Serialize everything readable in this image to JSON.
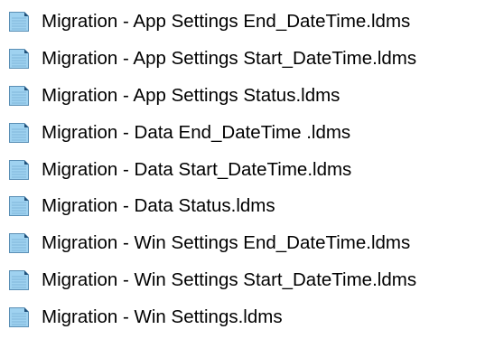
{
  "files": [
    {
      "name": "Migration - App Settings End_DateTime.ldms",
      "icon": "document-icon"
    },
    {
      "name": "Migration - App Settings Start_DateTime.ldms",
      "icon": "document-icon"
    },
    {
      "name": "Migration - App Settings Status.ldms",
      "icon": "document-icon"
    },
    {
      "name": "Migration - Data End_DateTime .ldms",
      "icon": "document-icon"
    },
    {
      "name": "Migration - Data Start_DateTime.ldms",
      "icon": "document-icon"
    },
    {
      "name": "Migration - Data Status.ldms",
      "icon": "document-icon"
    },
    {
      "name": "Migration - Win Settings End_DateTime.ldms",
      "icon": "document-icon"
    },
    {
      "name": "Migration - Win Settings Start_DateTime.ldms",
      "icon": "document-icon"
    },
    {
      "name": "Migration - Win Settings.ldms",
      "icon": "document-icon"
    }
  ],
  "colors": {
    "icon_fill": "#9fd2f0",
    "icon_border": "#5a8fb5",
    "icon_fold": "#1f4f78",
    "icon_lines": "#7fb6da"
  }
}
